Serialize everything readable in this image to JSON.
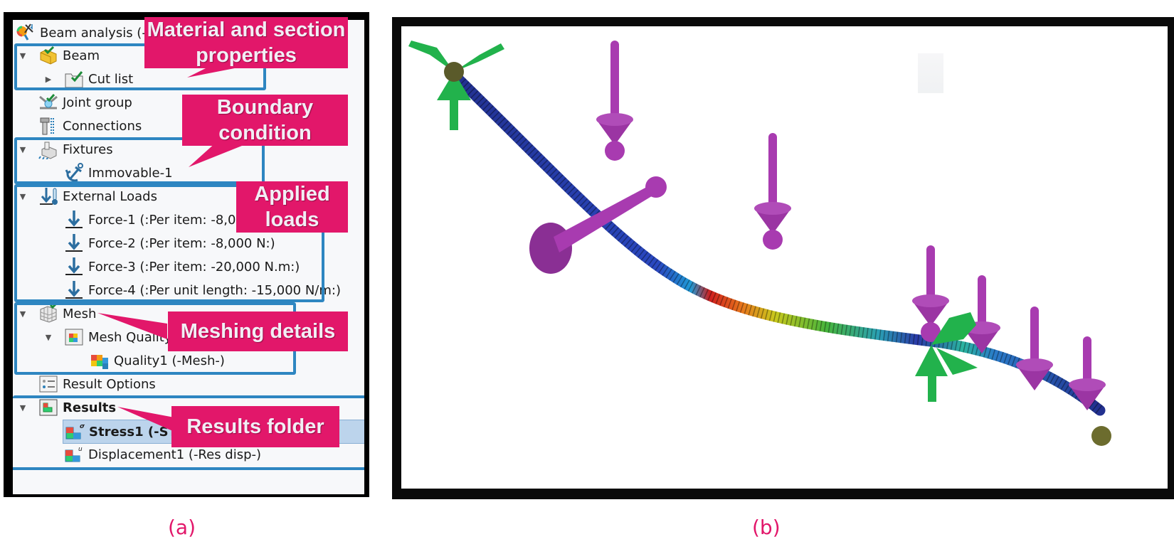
{
  "panel_a": {
    "caption": "(a)",
    "tree": {
      "root": {
        "label": "Beam analysis (-De",
        "icon": "study-icon"
      },
      "items": [
        {
          "label": "Beam",
          "icon": "beam-part-icon",
          "expanded": true
        },
        {
          "label": "Cut list",
          "icon": "cut-list-folder-icon",
          "expanded": false
        },
        {
          "label": "Joint group",
          "icon": "joint-group-icon"
        },
        {
          "label": "Connections",
          "icon": "connections-icon"
        },
        {
          "label": "Fixtures",
          "icon": "fixtures-icon",
          "expanded": true
        },
        {
          "label": "Immovable-1",
          "icon": "anchor-icon"
        },
        {
          "label": "External Loads",
          "icon": "external-loads-icon",
          "expanded": true
        },
        {
          "label": "Force-1 (:Per item: -8,000",
          "icon": "force-arrow-icon"
        },
        {
          "label": "Force-2 (:Per item: -8,000 N:)",
          "icon": "force-arrow-icon"
        },
        {
          "label": "Force-3 (:Per item: -20,000 N.m:)",
          "icon": "force-arrow-icon"
        },
        {
          "label": "Force-4 (:Per unit length: -15,000 N/m:)",
          "icon": "force-arrow-icon"
        },
        {
          "label": "Mesh",
          "icon": "mesh-icon",
          "expanded": true
        },
        {
          "label": "Mesh Quality",
          "icon": "mesh-quality-folder-icon",
          "expanded": true
        },
        {
          "label": "Quality1 (-Mesh-)",
          "icon": "quality-plot-icon"
        },
        {
          "label": "Result Options",
          "icon": "result-options-icon"
        },
        {
          "label": "Results",
          "icon": "results-folder-icon",
          "expanded": true
        },
        {
          "label": "Stress1 (-STR",
          "icon": "stress-plot-icon",
          "selected": true
        },
        {
          "label": "Displacement1 (-Res disp-)",
          "icon": "displacement-plot-icon"
        }
      ]
    },
    "callouts": {
      "material": "Material and section properties",
      "boundary": "Boundary condition",
      "loads": "Applied loads",
      "meshing": "Meshing details",
      "results": "Results folder"
    }
  },
  "panel_b": {
    "caption": "(b)",
    "description": "Deformed beam with stress color map, fixtures (green) and loads (magenta)"
  },
  "colors": {
    "callout": "#e2176a",
    "group_box": "#2e86c1",
    "fixture": "#22b24c",
    "load": "#a83bb0",
    "caption": "#e2176a"
  }
}
